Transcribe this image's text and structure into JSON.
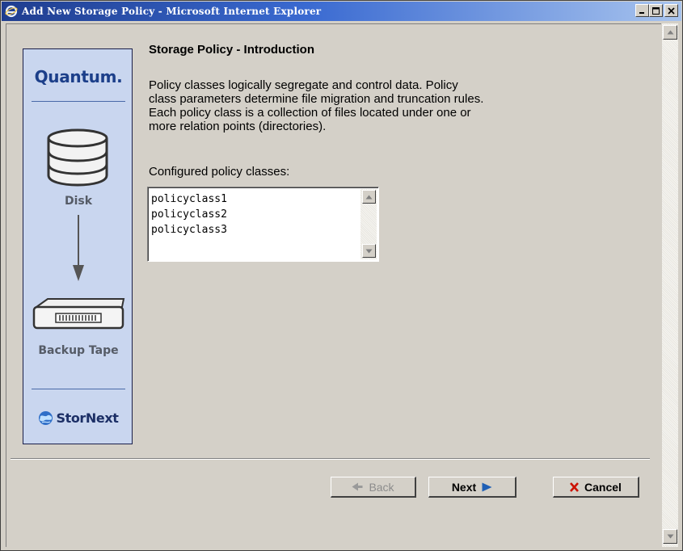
{
  "window": {
    "title": "Add New Storage Policy - Microsoft Internet Explorer",
    "controls": {
      "minimize": "minimize-icon",
      "maximize": "maximize-icon",
      "close": "close-icon"
    }
  },
  "sidebar": {
    "logo": "Quantum.",
    "disk_label": "Disk",
    "tape_label": "Backup Tape",
    "brand": "StorNext"
  },
  "main": {
    "heading": "Storage Policy - Introduction",
    "intro_lines": [
      "Policy classes logically segregate and control data. Policy",
      "class parameters determine file migration and truncation rules.",
      "Each policy class is a collection of files located under one or",
      "more relation points (directories)."
    ],
    "classes_label": "Configured policy classes:",
    "policy_classes": [
      "policyclass1",
      "policyclass2",
      "policyclass3"
    ]
  },
  "buttons": {
    "back": "Back",
    "next": "Next",
    "cancel": "Cancel"
  },
  "colors": {
    "sidebar_bg": "#c9d6ef",
    "brand_blue": "#1c3f8a",
    "next_arrow": "#1f5fb5",
    "cancel_x": "#cc1100",
    "titlebar_start": "#1f3d8f"
  }
}
